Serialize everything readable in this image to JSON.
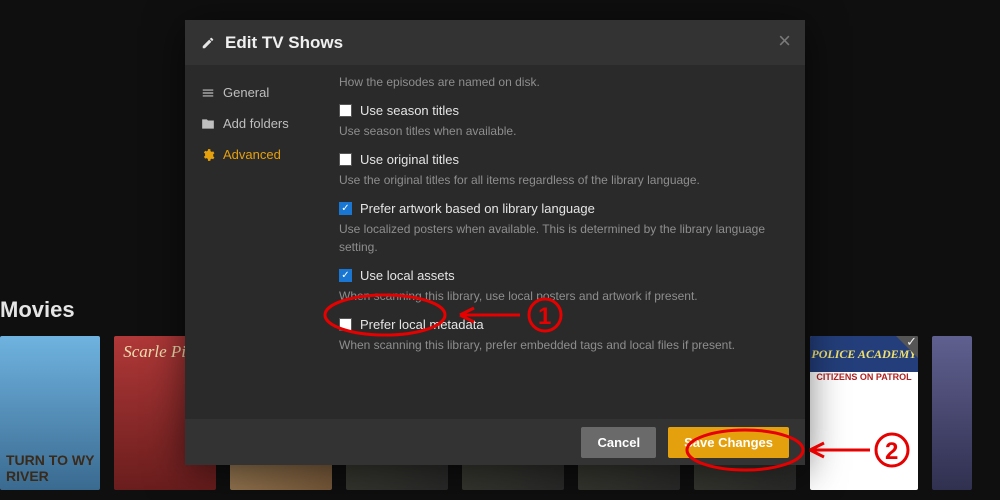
{
  "background": {
    "section_label": "Movies",
    "posters": {
      "p1_title": "TURN TO\nWY RIVER",
      "p2_title": "Scarle\nPimp",
      "p9_title": "POLICE ACADEMY",
      "p9_sub": "CITIZENS ON PATROL"
    }
  },
  "modal": {
    "title": "Edit TV Shows",
    "close": "×",
    "sidebar": [
      {
        "label": "General"
      },
      {
        "label": "Add folders"
      },
      {
        "label": "Advanced"
      }
    ],
    "top_desc": "How the episodes are named on disk.",
    "options": [
      {
        "label": "Use season titles",
        "checked": false,
        "desc": "Use season titles when available."
      },
      {
        "label": "Use original titles",
        "checked": false,
        "desc": "Use the original titles for all items regardless of the library language."
      },
      {
        "label": "Prefer artwork based on library language",
        "checked": true,
        "desc": "Use localized posters when available. This is determined by the library language setting."
      },
      {
        "label": "Use local assets",
        "checked": true,
        "desc": "When scanning this library, use local posters and artwork if present."
      },
      {
        "label": "Prefer local metadata",
        "checked": false,
        "desc": "When scanning this library, prefer embedded tags and local files if present."
      }
    ],
    "cancel": "Cancel",
    "save": "Save Changes"
  },
  "annotations": {
    "one": "1",
    "two": "2"
  }
}
